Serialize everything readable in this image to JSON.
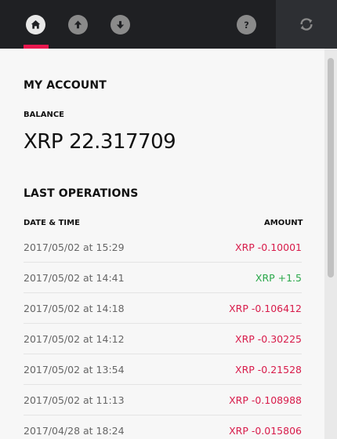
{
  "nav": {
    "home_icon": "home-icon",
    "upload_icon": "arrow-up-circle-icon",
    "download_icon": "arrow-down-circle-icon",
    "help_icon": "question-icon",
    "refresh_icon": "refresh-icon",
    "accent_color": "#e8174e"
  },
  "account": {
    "title": "MY ACCOUNT",
    "balance_label": "BALANCE",
    "currency": "XRP",
    "balance": "22.317709"
  },
  "operations": {
    "title": "LAST OPERATIONS",
    "col_datetime": "DATE & TIME",
    "col_amount": "AMOUNT",
    "rows": [
      {
        "datetime": "2017/05/02 at 15:29",
        "amount": "XRP -0.10001",
        "type": "neg"
      },
      {
        "datetime": "2017/05/02 at 14:41",
        "amount": "XRP +1.5",
        "type": "pos"
      },
      {
        "datetime": "2017/05/02 at 14:18",
        "amount": "XRP -0.106412",
        "type": "neg"
      },
      {
        "datetime": "2017/05/02 at 14:12",
        "amount": "XRP -0.30225",
        "type": "neg"
      },
      {
        "datetime": "2017/05/02 at 13:54",
        "amount": "XRP -0.21528",
        "type": "neg"
      },
      {
        "datetime": "2017/05/02 at 11:13",
        "amount": "XRP -0.108988",
        "type": "neg"
      },
      {
        "datetime": "2017/04/28 at 18:24",
        "amount": "XRP -0.015806",
        "type": "neg"
      }
    ]
  }
}
